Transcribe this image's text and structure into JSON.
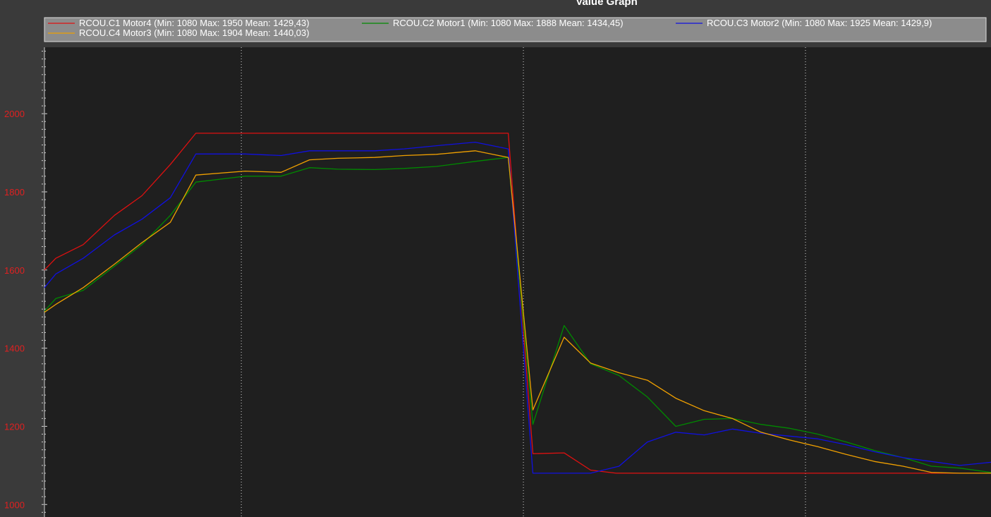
{
  "chart_data": {
    "type": "line",
    "title": "Value Graph",
    "xlabel": "",
    "ylabel": "",
    "ylim": [
      968,
      2170
    ],
    "xlim": [
      0,
      1
    ],
    "y_ticks": [
      1000,
      1200,
      1400,
      1600,
      1800,
      2000
    ],
    "grid": {
      "x": true,
      "y": false
    },
    "x_grid": [
      0.208,
      0.506,
      0.804
    ],
    "legend_position": "top",
    "series": [
      {
        "name": "RCOU.C1 Motor4 (Min: 1080 Max: 1950 Mean: 1429,43)",
        "color": "#e01010",
        "points": [
          [
            0.0,
            1600
          ],
          [
            0.012,
            1630
          ],
          [
            0.041,
            1665
          ],
          [
            0.074,
            1740
          ],
          [
            0.103,
            1790
          ],
          [
            0.133,
            1870
          ],
          [
            0.16,
            1950
          ],
          [
            0.49,
            1950
          ],
          [
            0.516,
            1130
          ],
          [
            0.549,
            1132
          ],
          [
            0.577,
            1088
          ],
          [
            0.604,
            1080
          ],
          [
            0.7,
            1080
          ],
          [
            0.8,
            1080
          ],
          [
            0.9,
            1080
          ],
          [
            1.0,
            1080
          ]
        ]
      },
      {
        "name": "RCOU.C2 Motor1 (Min: 1080 Max: 1888 Mean: 1434,45)",
        "color": "#008a00",
        "points": [
          [
            0.0,
            1495
          ],
          [
            0.012,
            1527
          ],
          [
            0.041,
            1548
          ],
          [
            0.074,
            1610
          ],
          [
            0.103,
            1665
          ],
          [
            0.133,
            1740
          ],
          [
            0.16,
            1825
          ],
          [
            0.212,
            1840
          ],
          [
            0.25,
            1840
          ],
          [
            0.28,
            1862
          ],
          [
            0.31,
            1858
          ],
          [
            0.349,
            1857
          ],
          [
            0.38,
            1860
          ],
          [
            0.414,
            1865
          ],
          [
            0.455,
            1878
          ],
          [
            0.49,
            1888
          ],
          [
            0.516,
            1205
          ],
          [
            0.549,
            1458
          ],
          [
            0.577,
            1360
          ],
          [
            0.607,
            1330
          ],
          [
            0.637,
            1275
          ],
          [
            0.667,
            1200
          ],
          [
            0.697,
            1218
          ],
          [
            0.727,
            1220
          ],
          [
            0.757,
            1205
          ],
          [
            0.787,
            1195
          ],
          [
            0.817,
            1180
          ],
          [
            0.847,
            1160
          ],
          [
            0.877,
            1138
          ],
          [
            0.907,
            1120
          ],
          [
            0.937,
            1098
          ],
          [
            0.967,
            1093
          ],
          [
            1.0,
            1082
          ]
        ]
      },
      {
        "name": "RCOU.C3 Motor2 (Min: 1080 Max: 1925 Mean: 1429,9)",
        "color": "#1010e0",
        "points": [
          [
            0.0,
            1555
          ],
          [
            0.012,
            1590
          ],
          [
            0.041,
            1630
          ],
          [
            0.074,
            1690
          ],
          [
            0.103,
            1730
          ],
          [
            0.133,
            1785
          ],
          [
            0.16,
            1897
          ],
          [
            0.212,
            1897
          ],
          [
            0.25,
            1893
          ],
          [
            0.28,
            1905
          ],
          [
            0.31,
            1905
          ],
          [
            0.349,
            1905
          ],
          [
            0.38,
            1910
          ],
          [
            0.414,
            1918
          ],
          [
            0.455,
            1927
          ],
          [
            0.49,
            1910
          ],
          [
            0.516,
            1080
          ],
          [
            0.549,
            1080
          ],
          [
            0.577,
            1080
          ],
          [
            0.607,
            1098
          ],
          [
            0.637,
            1160
          ],
          [
            0.667,
            1185
          ],
          [
            0.697,
            1178
          ],
          [
            0.727,
            1193
          ],
          [
            0.757,
            1182
          ],
          [
            0.787,
            1175
          ],
          [
            0.817,
            1168
          ],
          [
            0.847,
            1153
          ],
          [
            0.877,
            1135
          ],
          [
            0.907,
            1120
          ],
          [
            0.937,
            1110
          ],
          [
            0.967,
            1100
          ],
          [
            1.0,
            1108
          ]
        ]
      },
      {
        "name": "RCOU.C4 Motor3 (Min: 1080 Max: 1904 Mean: 1440,03)",
        "color": "#f0a000",
        "points": [
          [
            0.0,
            1492
          ],
          [
            0.012,
            1512
          ],
          [
            0.041,
            1555
          ],
          [
            0.074,
            1615
          ],
          [
            0.103,
            1670
          ],
          [
            0.133,
            1722
          ],
          [
            0.16,
            1843
          ],
          [
            0.212,
            1853
          ],
          [
            0.25,
            1850
          ],
          [
            0.28,
            1882
          ],
          [
            0.31,
            1886
          ],
          [
            0.349,
            1888
          ],
          [
            0.38,
            1893
          ],
          [
            0.414,
            1896
          ],
          [
            0.455,
            1905
          ],
          [
            0.49,
            1888
          ],
          [
            0.516,
            1242
          ],
          [
            0.549,
            1428
          ],
          [
            0.577,
            1362
          ],
          [
            0.607,
            1337
          ],
          [
            0.637,
            1318
          ],
          [
            0.667,
            1272
          ],
          [
            0.697,
            1240
          ],
          [
            0.727,
            1220
          ],
          [
            0.757,
            1185
          ],
          [
            0.787,
            1165
          ],
          [
            0.817,
            1148
          ],
          [
            0.847,
            1128
          ],
          [
            0.877,
            1110
          ],
          [
            0.907,
            1098
          ],
          [
            0.937,
            1082
          ],
          [
            0.967,
            1080
          ],
          [
            1.0,
            1080
          ]
        ]
      }
    ]
  }
}
